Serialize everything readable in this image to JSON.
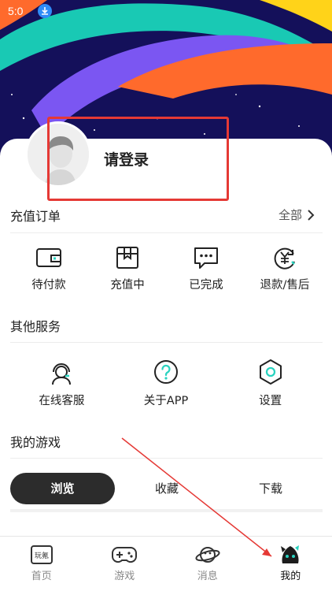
{
  "status_bar": {
    "time": "5:0"
  },
  "profile": {
    "login_text": "请登录"
  },
  "recharge_orders": {
    "title": "充值订单",
    "view_all": "全部",
    "items": [
      {
        "label": "待付款",
        "icon": "wallet-icon"
      },
      {
        "label": "充值中",
        "icon": "box-icon"
      },
      {
        "label": "已完成",
        "icon": "message-dots-icon"
      },
      {
        "label": "退款/售后",
        "icon": "yen-refund-icon"
      }
    ]
  },
  "other_services": {
    "title": "其他服务",
    "items": [
      {
        "label": "在线客服",
        "icon": "customer-service-icon"
      },
      {
        "label": "关于APP",
        "icon": "question-icon"
      },
      {
        "label": "设置",
        "icon": "gear-icon"
      }
    ]
  },
  "my_games": {
    "title": "我的游戏",
    "tabs": [
      "浏览",
      "收藏",
      "下载"
    ],
    "active_tab": "浏览"
  },
  "bottom_nav": {
    "items": [
      {
        "label": "首页",
        "icon": "home-logo-icon",
        "logo_text": "玩氪"
      },
      {
        "label": "游戏",
        "icon": "gamepad-icon"
      },
      {
        "label": "消息",
        "icon": "planet-icon"
      },
      {
        "label": "我的",
        "icon": "profile-character-icon"
      }
    ],
    "active": "我的"
  },
  "colors": {
    "accent": "#2ad3c0",
    "highlight_box": "#e53935",
    "hero_bg": "#14105a"
  }
}
